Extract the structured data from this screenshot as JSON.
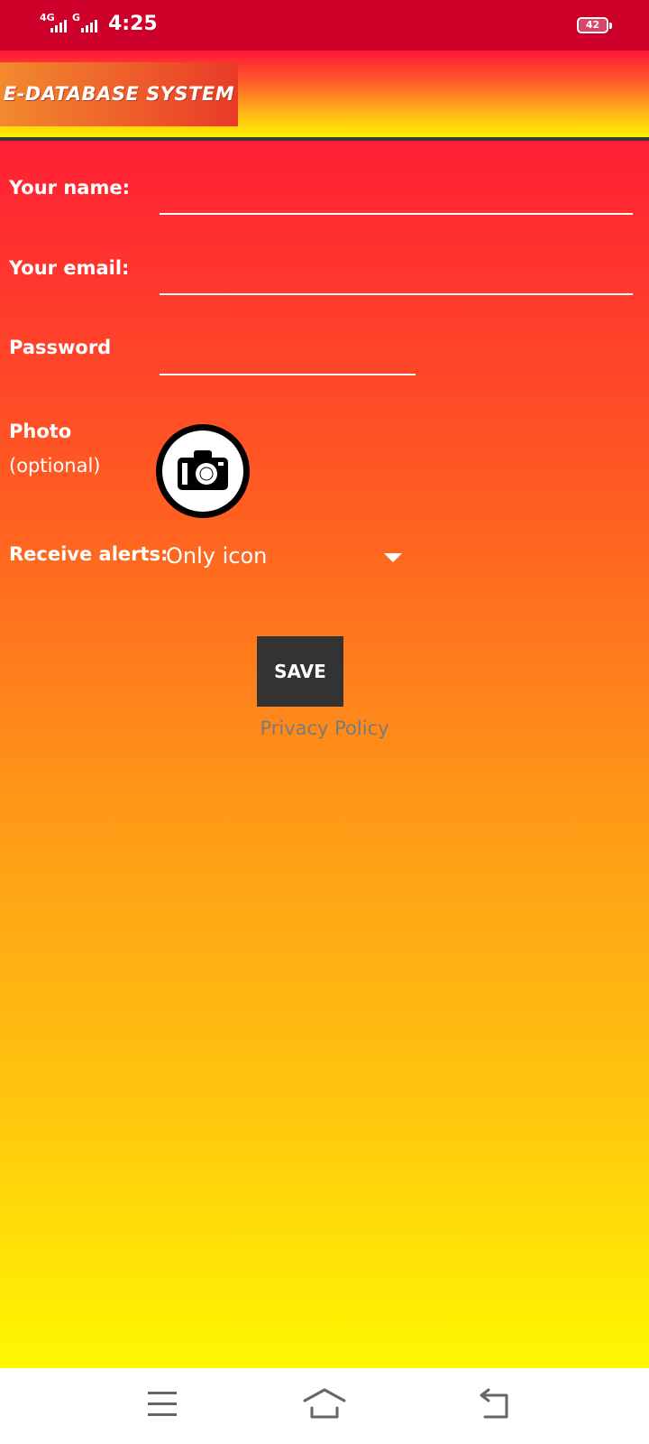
{
  "status_bar": {
    "network_1": "4G",
    "network_2": "G",
    "time": "4:25",
    "battery": "42",
    "icons": [
      "signal-icon",
      "signal-icon",
      "battery-icon"
    ]
  },
  "app_bar": {
    "title": "E-DATABASE SYSTEM"
  },
  "form": {
    "name_label": "Your name:",
    "name_value": "",
    "email_label": "Your email:",
    "email_value": "",
    "password_label": "Password",
    "password_value": "",
    "photo_label": "Photo",
    "photo_optional": "(optional)",
    "photo_icon": "camera-icon",
    "alerts_label": "Receive alerts:",
    "alerts_selected": "Only icon",
    "save_label": "SAVE",
    "privacy_label": "Privacy Policy"
  },
  "nav_bar": {
    "icons": [
      "menu-icon",
      "home-icon",
      "back-icon"
    ]
  },
  "colors": {
    "status_bar": "#cc0029",
    "gradient_top": "#ff1f35",
    "gradient_bottom": "#fff800",
    "button": "#333333",
    "link": "#7a7a7a"
  }
}
